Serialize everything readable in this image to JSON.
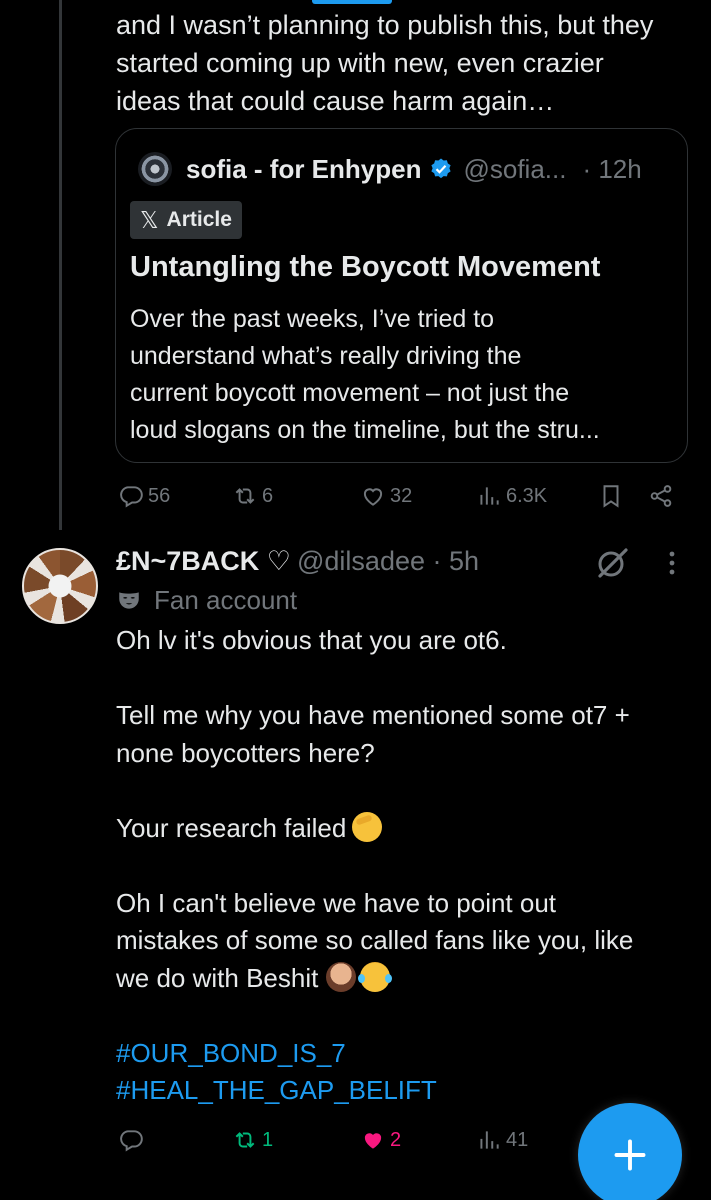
{
  "first_tweet": {
    "text_lines": [
      "and I wasn’t planning to publish this, but they",
      "started coming up with new, even crazier",
      "ideas that could cause harm again…"
    ],
    "quote": {
      "name": "sofia - for Enhypen",
      "handle": "@sofia...",
      "time": "· 12h",
      "badge": "Article",
      "badge_icon": "𝕏",
      "title": "Untangling the Boycott Movement",
      "desc_lines": [
        "Over the past weeks, I’ve tried to",
        "understand what’s really driving the",
        "current boycott movement – not just the",
        "loud slogans on the timeline, but the stru..."
      ]
    },
    "actions": {
      "replies": "56",
      "reposts": "6",
      "likes": "32",
      "views": "6.3K"
    }
  },
  "second_tweet": {
    "name": "£N~7BACK ♡",
    "handle": "@dilsadee · 5h",
    "label": "Fan account",
    "line1": "Oh lv it's obvious that you are ot6.",
    "line2a": "Tell me why you have mentioned some ot7 +",
    "line2b": "none boycotters here?",
    "line3": "Your research failed",
    "line4a": "Oh I can't believe we have to point out",
    "line4b": "mistakes of some so called fans like you, like",
    "line4c": "we do with Beshit",
    "hashtag1": "#OUR_BOND_IS_7",
    "hashtag2": "#HEAL_THE_GAP_BELIFT",
    "actions": {
      "replies": "",
      "reposts": "1",
      "likes": "2",
      "views": "41"
    }
  },
  "colors": {
    "accent": "#1d9bf0",
    "muted": "#71767b",
    "repost_active": "#00ba7c",
    "like_active": "#f91880"
  },
  "icons": [
    "x-logo-icon",
    "verified-badge-icon",
    "reply-icon",
    "repost-icon",
    "like-icon",
    "views-icon",
    "bookmark-icon",
    "share-icon",
    "grok-icon",
    "more-icon",
    "mask-icon",
    "plus-icon"
  ]
}
